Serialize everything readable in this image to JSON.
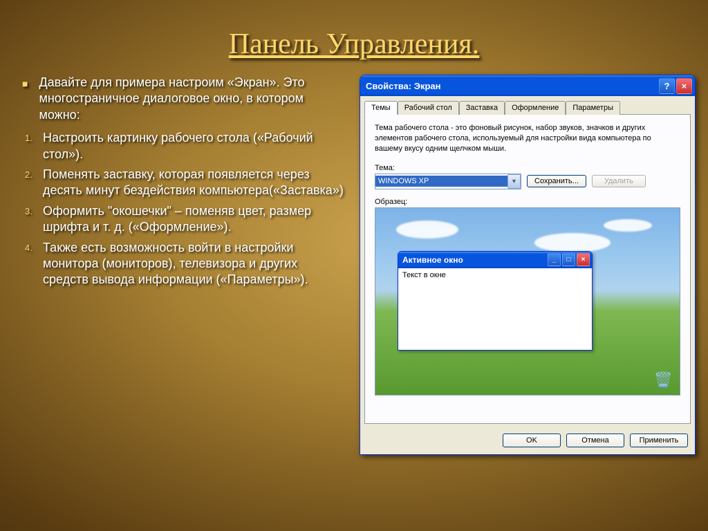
{
  "slide": {
    "title": "Панель Управления.",
    "intro": "Давайте для примера настроим «Экран». Это многостраничное диалоговое окно, в котором можно:",
    "items": [
      "Настроить картинку рабочего стола («Рабочий стол»).",
      "Поменять заставку, которая появляется через десять минут бездействия компьютера(«Заставка»)",
      "Оформить \"окошечки\" – поменяв цвет, размер шрифта и т. д. («Оформление»).",
      "Также есть возможность войти в настройки монитора (мониторов), телевизора и других средств вывода информации («Параметры»)."
    ]
  },
  "dialog": {
    "title": "Свойства: Экран",
    "tabs": [
      "Темы",
      "Рабочий стол",
      "Заставка",
      "Оформление",
      "Параметры"
    ],
    "active_tab_index": 0,
    "description": "Тема рабочего стола - это фоновый рисунок, набор звуков, значков и других элементов рабочего стола, используемый для настройки вида компьютера по вашему вкусу одним щелчком мыши.",
    "theme_label": "Тема:",
    "theme_value": "WINDOWS XP",
    "save_btn": "Сохранить...",
    "delete_btn": "Удалить",
    "preview_label": "Образец:",
    "inner_window_title": "Активное окно",
    "inner_window_text": "Текст в окне",
    "buttons": {
      "ok": "OK",
      "cancel": "Отмена",
      "apply": "Применить"
    }
  }
}
